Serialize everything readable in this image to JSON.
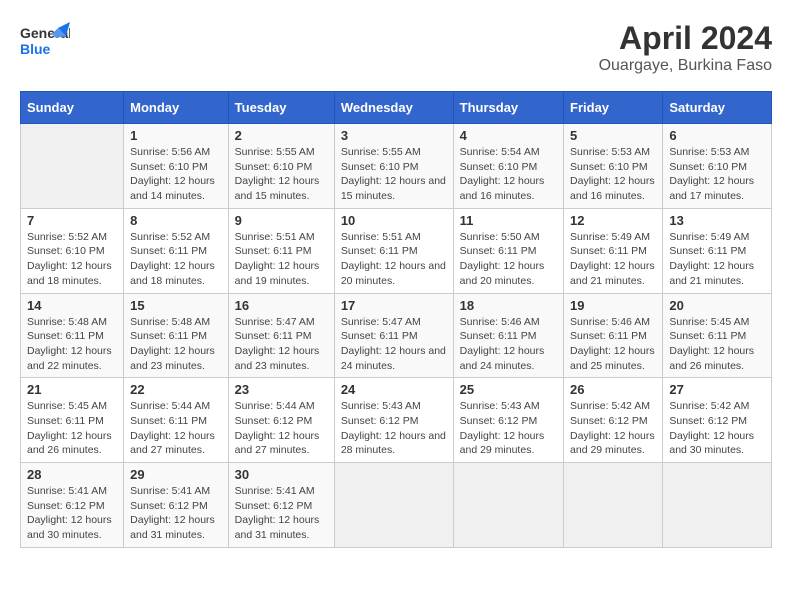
{
  "header": {
    "logo_general": "General",
    "logo_blue": "Blue",
    "title": "April 2024",
    "subtitle": "Ouargaye, Burkina Faso"
  },
  "days_of_week": [
    "Sunday",
    "Monday",
    "Tuesday",
    "Wednesday",
    "Thursday",
    "Friday",
    "Saturday"
  ],
  "weeks": [
    [
      {
        "day": "",
        "info": ""
      },
      {
        "day": "1",
        "info": "Sunrise: 5:56 AM\nSunset: 6:10 PM\nDaylight: 12 hours and 14 minutes."
      },
      {
        "day": "2",
        "info": "Sunrise: 5:55 AM\nSunset: 6:10 PM\nDaylight: 12 hours and 15 minutes."
      },
      {
        "day": "3",
        "info": "Sunrise: 5:55 AM\nSunset: 6:10 PM\nDaylight: 12 hours and 15 minutes."
      },
      {
        "day": "4",
        "info": "Sunrise: 5:54 AM\nSunset: 6:10 PM\nDaylight: 12 hours and 16 minutes."
      },
      {
        "day": "5",
        "info": "Sunrise: 5:53 AM\nSunset: 6:10 PM\nDaylight: 12 hours and 16 minutes."
      },
      {
        "day": "6",
        "info": "Sunrise: 5:53 AM\nSunset: 6:10 PM\nDaylight: 12 hours and 17 minutes."
      }
    ],
    [
      {
        "day": "7",
        "info": "Sunrise: 5:52 AM\nSunset: 6:10 PM\nDaylight: 12 hours and 18 minutes."
      },
      {
        "day": "8",
        "info": "Sunrise: 5:52 AM\nSunset: 6:11 PM\nDaylight: 12 hours and 18 minutes."
      },
      {
        "day": "9",
        "info": "Sunrise: 5:51 AM\nSunset: 6:11 PM\nDaylight: 12 hours and 19 minutes."
      },
      {
        "day": "10",
        "info": "Sunrise: 5:51 AM\nSunset: 6:11 PM\nDaylight: 12 hours and 20 minutes."
      },
      {
        "day": "11",
        "info": "Sunrise: 5:50 AM\nSunset: 6:11 PM\nDaylight: 12 hours and 20 minutes."
      },
      {
        "day": "12",
        "info": "Sunrise: 5:49 AM\nSunset: 6:11 PM\nDaylight: 12 hours and 21 minutes."
      },
      {
        "day": "13",
        "info": "Sunrise: 5:49 AM\nSunset: 6:11 PM\nDaylight: 12 hours and 21 minutes."
      }
    ],
    [
      {
        "day": "14",
        "info": "Sunrise: 5:48 AM\nSunset: 6:11 PM\nDaylight: 12 hours and 22 minutes."
      },
      {
        "day": "15",
        "info": "Sunrise: 5:48 AM\nSunset: 6:11 PM\nDaylight: 12 hours and 23 minutes."
      },
      {
        "day": "16",
        "info": "Sunrise: 5:47 AM\nSunset: 6:11 PM\nDaylight: 12 hours and 23 minutes."
      },
      {
        "day": "17",
        "info": "Sunrise: 5:47 AM\nSunset: 6:11 PM\nDaylight: 12 hours and 24 minutes."
      },
      {
        "day": "18",
        "info": "Sunrise: 5:46 AM\nSunset: 6:11 PM\nDaylight: 12 hours and 24 minutes."
      },
      {
        "day": "19",
        "info": "Sunrise: 5:46 AM\nSunset: 6:11 PM\nDaylight: 12 hours and 25 minutes."
      },
      {
        "day": "20",
        "info": "Sunrise: 5:45 AM\nSunset: 6:11 PM\nDaylight: 12 hours and 26 minutes."
      }
    ],
    [
      {
        "day": "21",
        "info": "Sunrise: 5:45 AM\nSunset: 6:11 PM\nDaylight: 12 hours and 26 minutes."
      },
      {
        "day": "22",
        "info": "Sunrise: 5:44 AM\nSunset: 6:11 PM\nDaylight: 12 hours and 27 minutes."
      },
      {
        "day": "23",
        "info": "Sunrise: 5:44 AM\nSunset: 6:12 PM\nDaylight: 12 hours and 27 minutes."
      },
      {
        "day": "24",
        "info": "Sunrise: 5:43 AM\nSunset: 6:12 PM\nDaylight: 12 hours and 28 minutes."
      },
      {
        "day": "25",
        "info": "Sunrise: 5:43 AM\nSunset: 6:12 PM\nDaylight: 12 hours and 29 minutes."
      },
      {
        "day": "26",
        "info": "Sunrise: 5:42 AM\nSunset: 6:12 PM\nDaylight: 12 hours and 29 minutes."
      },
      {
        "day": "27",
        "info": "Sunrise: 5:42 AM\nSunset: 6:12 PM\nDaylight: 12 hours and 30 minutes."
      }
    ],
    [
      {
        "day": "28",
        "info": "Sunrise: 5:41 AM\nSunset: 6:12 PM\nDaylight: 12 hours and 30 minutes."
      },
      {
        "day": "29",
        "info": "Sunrise: 5:41 AM\nSunset: 6:12 PM\nDaylight: 12 hours and 31 minutes."
      },
      {
        "day": "30",
        "info": "Sunrise: 5:41 AM\nSunset: 6:12 PM\nDaylight: 12 hours and 31 minutes."
      },
      {
        "day": "",
        "info": ""
      },
      {
        "day": "",
        "info": ""
      },
      {
        "day": "",
        "info": ""
      },
      {
        "day": "",
        "info": ""
      }
    ]
  ]
}
